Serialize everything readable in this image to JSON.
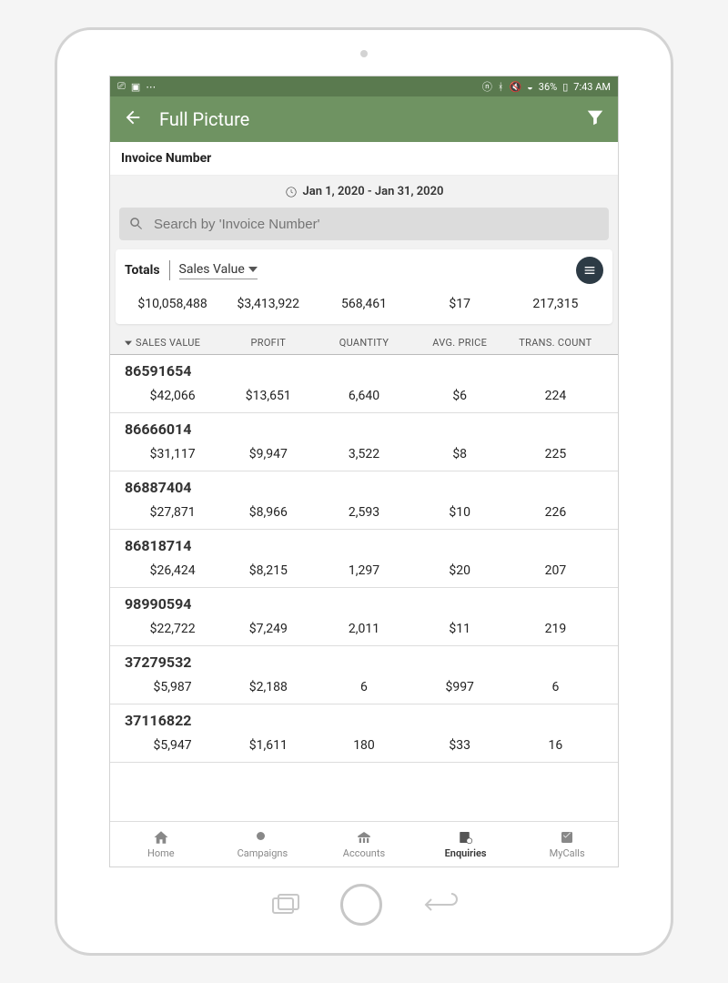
{
  "statusbar": {
    "battery": "36%",
    "time": "7:43 AM"
  },
  "appbar": {
    "title": "Full Picture"
  },
  "section_label": "Invoice Number",
  "date_range": "Jan 1, 2020 - Jan 31, 2020",
  "search": {
    "placeholder": "Search by 'Invoice Number'"
  },
  "totals": {
    "label": "Totals",
    "sort_by": "Sales Value",
    "values": {
      "sales_value": "$10,058,488",
      "profit": "$3,413,922",
      "quantity": "568,461",
      "avg_price": "$17",
      "trans_count": "217,315"
    }
  },
  "columns": {
    "sales_value": "SALES VALUE",
    "profit": "PROFIT",
    "quantity": "QUANTITY",
    "avg_price": "AVG. PRICE",
    "trans_count": "TRANS. COUNT"
  },
  "rows": [
    {
      "id": "86591654",
      "sales_value": "$42,066",
      "profit": "$13,651",
      "quantity": "6,640",
      "avg_price": "$6",
      "trans_count": "224"
    },
    {
      "id": "86666014",
      "sales_value": "$31,117",
      "profit": "$9,947",
      "quantity": "3,522",
      "avg_price": "$8",
      "trans_count": "225"
    },
    {
      "id": "86887404",
      "sales_value": "$27,871",
      "profit": "$8,966",
      "quantity": "2,593",
      "avg_price": "$10",
      "trans_count": "226"
    },
    {
      "id": "86818714",
      "sales_value": "$26,424",
      "profit": "$8,215",
      "quantity": "1,297",
      "avg_price": "$20",
      "trans_count": "207"
    },
    {
      "id": "98990594",
      "sales_value": "$22,722",
      "profit": "$7,249",
      "quantity": "2,011",
      "avg_price": "$11",
      "trans_count": "219"
    },
    {
      "id": "37279532",
      "sales_value": "$5,987",
      "profit": "$2,188",
      "quantity": "6",
      "avg_price": "$997",
      "trans_count": "6"
    },
    {
      "id": "37116822",
      "sales_value": "$5,947",
      "profit": "$1,611",
      "quantity": "180",
      "avg_price": "$33",
      "trans_count": "16"
    }
  ],
  "bottomnav": {
    "home": "Home",
    "campaigns": "Campaigns",
    "accounts": "Accounts",
    "enquiries": "Enquiries",
    "mycalls": "MyCalls"
  }
}
